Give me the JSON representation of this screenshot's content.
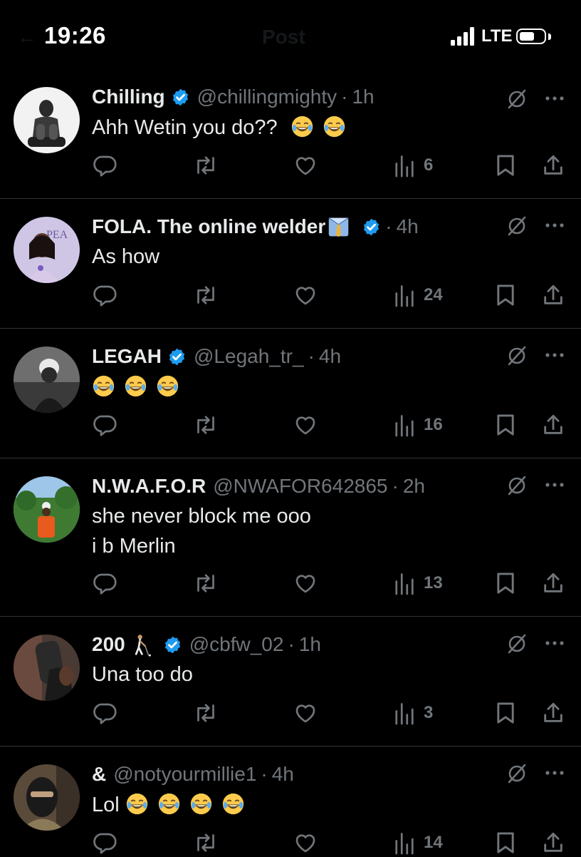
{
  "status_bar": {
    "time": "19:26",
    "network": "LTE",
    "header_title_faded": "Post"
  },
  "replies": [
    {
      "display_name": "Chilling",
      "verified": true,
      "handle": "@chillingmighty",
      "separator": "·",
      "time": "1h",
      "text_lines": [
        "Ahh Wetin you do??"
      ],
      "trailing_emoji": [
        "face-with-tears-of-joy",
        "face-with-tears-of-joy"
      ],
      "views": "6"
    },
    {
      "display_name": "FOLA. The online welder",
      "name_emoji": "necktie-shirt-emoji",
      "verified": true,
      "handle": "",
      "separator": "·",
      "time": "4h",
      "text_lines": [
        "As how"
      ],
      "views": "24"
    },
    {
      "display_name": "LEGAH",
      "verified": true,
      "handle": "@Legah_tr_",
      "separator": "·",
      "time": "4h",
      "text_lines": [
        ""
      ],
      "trailing_emoji": [
        "face-with-tears-of-joy",
        "face-with-tears-of-joy",
        "face-with-tears-of-joy"
      ],
      "views": "16"
    },
    {
      "display_name": "N.W.A.F.O.R",
      "verified": false,
      "handle": "@NWAFOR642865",
      "separator": "·",
      "time": "2h",
      "text_lines": [
        "she never block me ooo",
        "i b Merlin"
      ],
      "views": "13"
    },
    {
      "display_name": "200",
      "name_emoji": "golfer-emoji",
      "verified": true,
      "handle": "@cbfw_02",
      "separator": "·",
      "time": "1h",
      "text_lines": [
        "Una too do"
      ],
      "views": "3"
    },
    {
      "display_name": "&",
      "verified": false,
      "handle": "@notyourmillie1",
      "separator": "·",
      "time": "4h",
      "text_lines": [
        "Lol"
      ],
      "trailing_emoji": [
        "face-with-tears-of-joy",
        "face-with-tears-of-joy",
        "face-with-tears-of-joy",
        "face-with-tears-of-joy"
      ],
      "views": "14"
    }
  ],
  "colors": {
    "background": "#000000",
    "text_primary": "#e7e9ea",
    "text_secondary": "#71767b",
    "verified_blue": "#1d9bf0",
    "divider": "#2f3336"
  },
  "icons": {
    "reply": "reply-icon",
    "repost": "repost-icon",
    "like": "like-icon",
    "views": "views-icon",
    "bookmark": "bookmark-icon",
    "share": "share-icon",
    "grok": "grok-icon",
    "more": "more-icon"
  }
}
